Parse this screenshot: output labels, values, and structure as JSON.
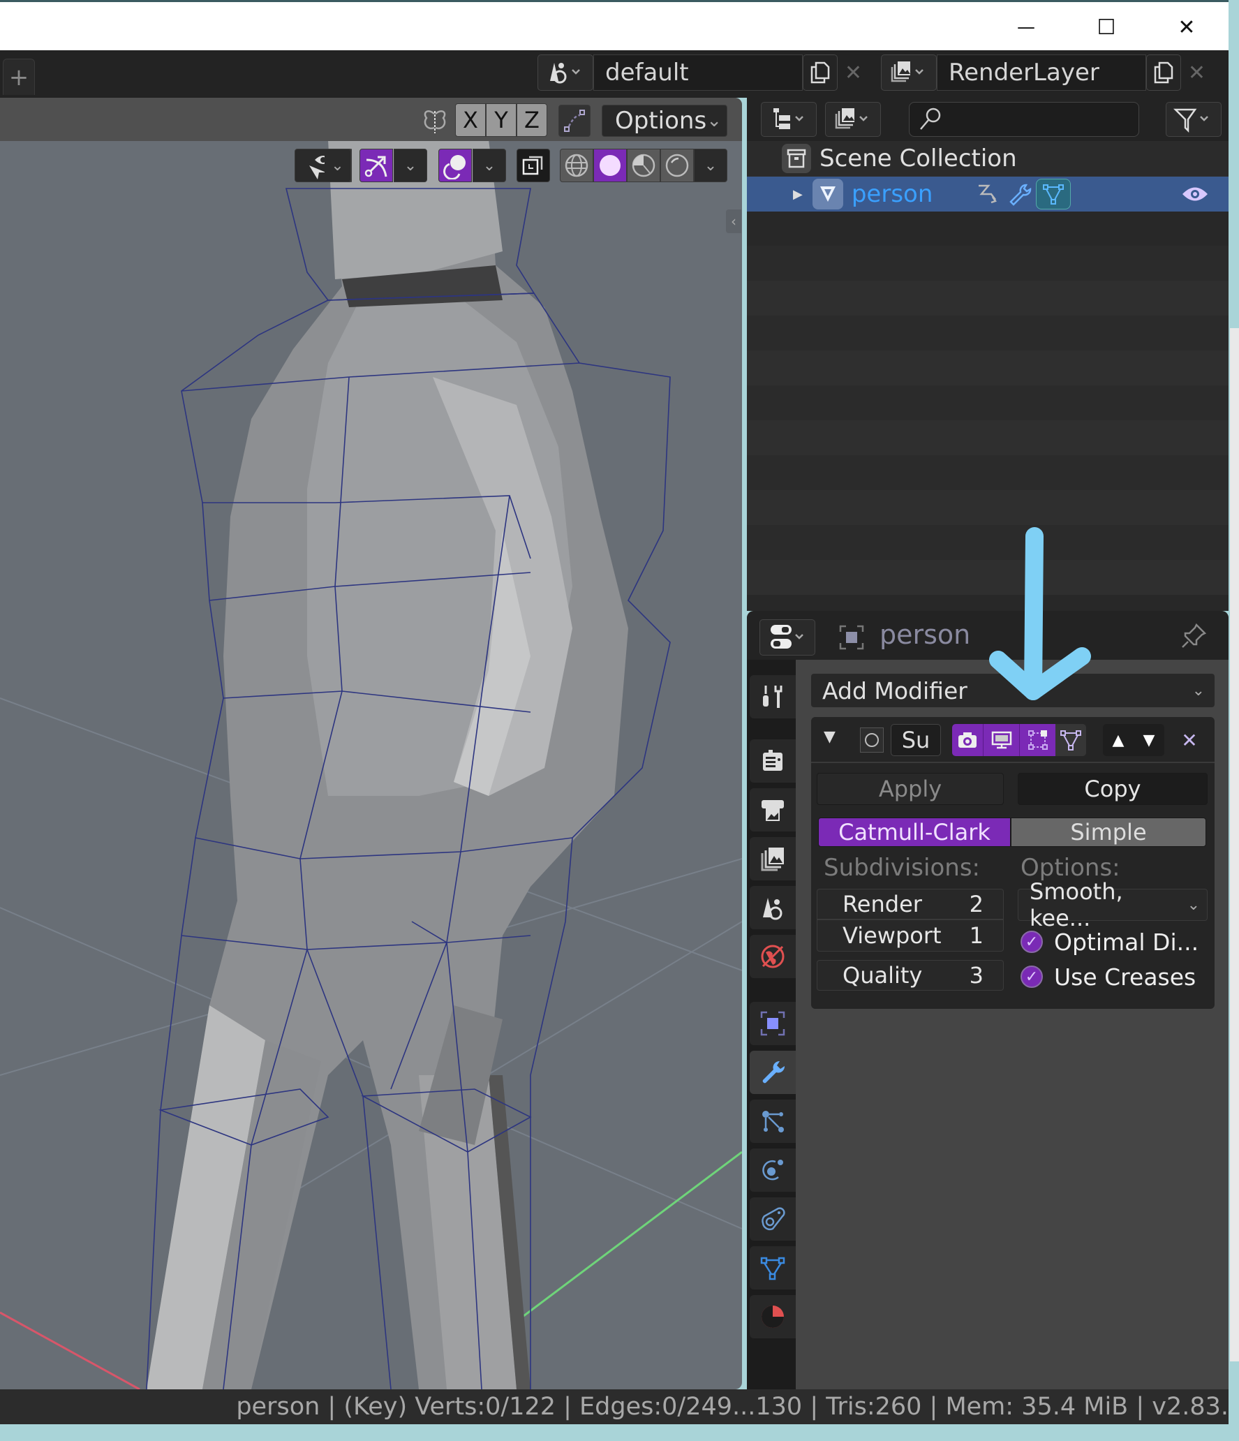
{
  "window": {
    "minimize_icon": "minimize-icon",
    "maximize_icon": "maximize-icon",
    "close_icon": "close-icon",
    "minimize_glyph": "—",
    "maximize_glyph": "☐",
    "close_glyph": "✕"
  },
  "topbar": {
    "add_tab_label": "+",
    "scene_field": "default",
    "view_layer_field": "RenderLayer",
    "close_glyph": "✕"
  },
  "viewport": {
    "axis_buttons": [
      "X",
      "Y",
      "Z"
    ],
    "options_label": "Options",
    "chevron": "⌄",
    "shading_modes": [
      "wireframe",
      "solid",
      "material-preview",
      "rendered"
    ],
    "active_shading": "solid"
  },
  "outliner": {
    "search_placeholder": "",
    "scene_collection_label": "Scene Collection",
    "object_label": "person"
  },
  "properties": {
    "object_name": "person",
    "add_modifier_label": "Add Modifier",
    "modifier": {
      "name_abbrev": "Su",
      "apply_label": "Apply",
      "copy_label": "Copy",
      "algorithm_options": [
        "Catmull-Clark",
        "Simple"
      ],
      "active_algorithm": "Catmull-Clark",
      "subdivisions_label": "Subdivisions:",
      "options_label": "Options:",
      "fields": [
        {
          "label": "Render",
          "value": "2"
        },
        {
          "label": "Viewport",
          "value": "1"
        },
        {
          "label": "Quality",
          "value": "3"
        }
      ],
      "uv_smooth_value": "Smooth, kee...",
      "checkboxes": [
        {
          "label": "Optimal Di...",
          "checked": true
        },
        {
          "label": "Use Creases",
          "checked": true
        }
      ]
    },
    "tabs": [
      "tool",
      "render",
      "output",
      "view-layer",
      "scene",
      "world",
      "object",
      "modifiers",
      "particles",
      "physics",
      "constraints",
      "data",
      "material"
    ],
    "active_tab": "modifiers"
  },
  "status": {
    "text": "person | (Key) Verts:0/122 | Edges:0/249...130 | Tris:260 | Mem: 35.4 MiB | v2.83."
  },
  "colors": {
    "accent_purple": "#7b2ab6",
    "selection_blue": "#3a5a8f",
    "object_text_blue": "#3aa0ff",
    "annotation_arrow": "#7fd0f5"
  }
}
